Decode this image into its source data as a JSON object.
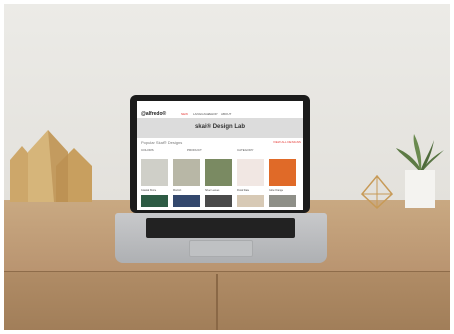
{
  "site": {
    "logo_text": "@alfredo®",
    "nav": [
      "NEW",
      "LANGUAGE",
      "SHOP",
      "ABOUT"
    ],
    "banner_title": "skai® Design Lab",
    "section_heading": "Popular Skai® Designs",
    "section_link": "VIEW ALL DESIGNS",
    "filters": [
      "COLORS",
      "PRODUCT",
      "CATEGORY"
    ],
    "tile_labels": [
      "Coastal Shore",
      "Mod Art",
      "Silver Leaves",
      "Floral Slate",
      "Glow Orange"
    ]
  },
  "colors": {
    "accent_red": "#e53935",
    "tile_1": "#cfcfc8",
    "tile_2": "#b8b7a6",
    "tile_3": "#7a8a62",
    "tile_4": "#f1e7e3",
    "tile_5": "#e06a28"
  },
  "objects": {
    "left_decor": "gold-geometric-houses-icon",
    "right_decor": "potted-plant-icon",
    "small_decor": "gold-wire-geometric-icon"
  }
}
